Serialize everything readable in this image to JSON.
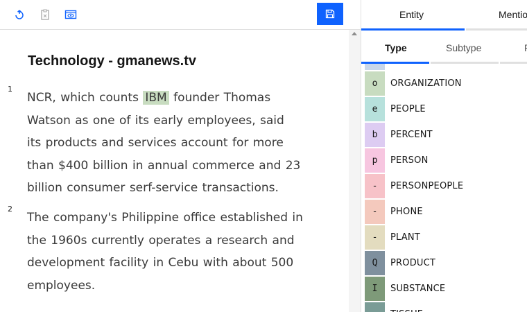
{
  "document": {
    "title": "Technology - gmanews.tv",
    "paragraphs": [
      {
        "number": "1",
        "lines": [
          {
            "before": "NCR, which counts ",
            "mention": "IBM",
            "after": " founder Thomas"
          },
          {
            "text": "Watson as one of its early employees, said"
          },
          {
            "text": "its products and services account for more"
          },
          {
            "text": "than $400 billion in annual commerce and 23"
          },
          {
            "text": " billion consumer serf-service transactions."
          }
        ]
      },
      {
        "number": "2",
        "lines": [
          {
            "text": "The company's Philippine office established in"
          },
          {
            "text": " the 1960s currently operates a research and"
          },
          {
            "text": "development facility in Cebu with about 500"
          },
          {
            "text": "employees."
          }
        ]
      }
    ]
  },
  "toolbar": {
    "icons": [
      "refresh-icon",
      "clipboard-icon",
      "view-icon"
    ],
    "save_icon": "save-icon"
  },
  "right_panel": {
    "tabs": [
      {
        "label": "Entity",
        "active": true
      },
      {
        "label": "Mentio",
        "active": false
      }
    ],
    "subtabs": [
      {
        "label": "Type",
        "active": true
      },
      {
        "label": "Subtype",
        "active": false
      },
      {
        "label": "R",
        "active": false
      }
    ],
    "types": [
      {
        "key": "",
        "label": "",
        "color": "#c9d7ea"
      },
      {
        "key": "o",
        "label": "ORGANIZATION",
        "color": "#c8dcc0"
      },
      {
        "key": "e",
        "label": "PEOPLE",
        "color": "#b7e1dc"
      },
      {
        "key": "b",
        "label": "PERCENT",
        "color": "#ddccf2"
      },
      {
        "key": "p",
        "label": "PERSON",
        "color": "#f7c6e0"
      },
      {
        "key": "-",
        "label": "PERSONPEOPLE",
        "color": "#f7c2c8"
      },
      {
        "key": "-",
        "label": "PHONE",
        "color": "#f4c9bd"
      },
      {
        "key": "-",
        "label": "PLANT",
        "color": "#e3dcbf"
      },
      {
        "key": "Q",
        "label": "PRODUCT",
        "color": "#7f909e"
      },
      {
        "key": "I",
        "label": "SUBSTANCE",
        "color": "#7e9a79"
      },
      {
        "key": "",
        "label": "TISSUE",
        "color": "#7a9c96"
      }
    ]
  },
  "colors": {
    "accent": "#0f62fe",
    "mention_highlight": "#c8dcc0"
  }
}
